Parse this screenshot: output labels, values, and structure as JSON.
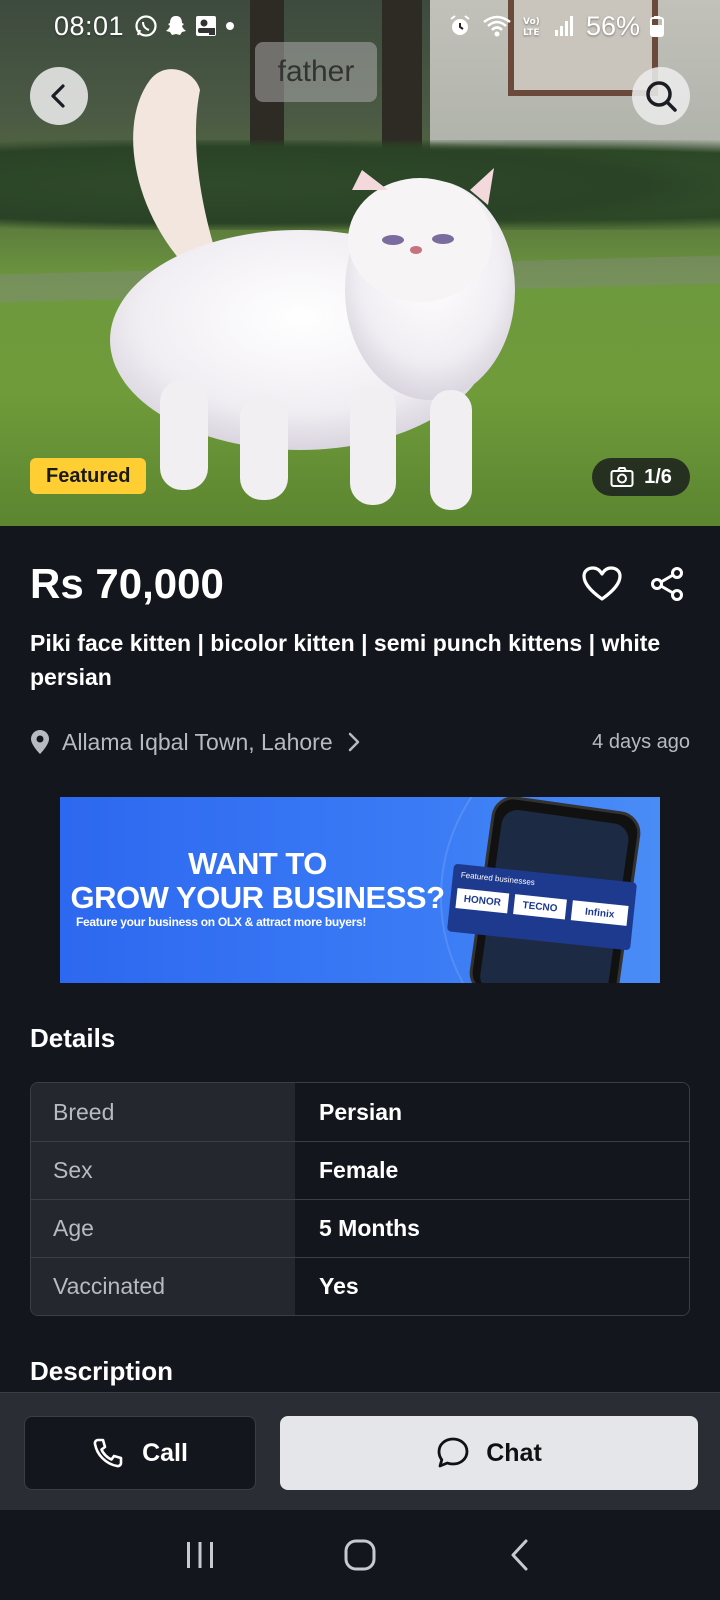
{
  "status_bar": {
    "time": "08:01",
    "battery": "56%",
    "icons_left": [
      "whatsapp-icon",
      "snapchat-icon",
      "contact-card-icon",
      "dot-icon"
    ],
    "icons_right": [
      "alarm-icon",
      "wifi-icon",
      "volte-icon",
      "signal-icon",
      "battery-icon"
    ]
  },
  "hero": {
    "watermark": "father",
    "featured_label": "Featured",
    "photo_counter": "1/6"
  },
  "listing": {
    "price": "Rs 70,000",
    "title": "Piki face kitten | bicolor kitten | semi punch kittens | white persian",
    "location": "Allama Iqbal Town, Lahore",
    "posted": "4 days ago"
  },
  "banner": {
    "headline_line1": "WANT TO",
    "headline_line2": "GROW YOUR BUSINESS?",
    "subline": "Feature your business on OLX & attract more buyers!",
    "featured_label": "Featured businesses",
    "brands": [
      "HONOR",
      "TECNO",
      "Infinix"
    ]
  },
  "details": {
    "heading": "Details",
    "rows": [
      {
        "label": "Breed",
        "value": "Persian"
      },
      {
        "label": "Sex",
        "value": "Female"
      },
      {
        "label": "Age",
        "value": "5 Months"
      },
      {
        "label": "Vaccinated",
        "value": "Yes"
      }
    ]
  },
  "description": {
    "heading": "Description"
  },
  "actions": {
    "call_label": "Call",
    "chat_label": "Chat"
  },
  "colors": {
    "background": "#13161c",
    "featured": "#ffce32",
    "banner_blue": "#2d68f0"
  }
}
